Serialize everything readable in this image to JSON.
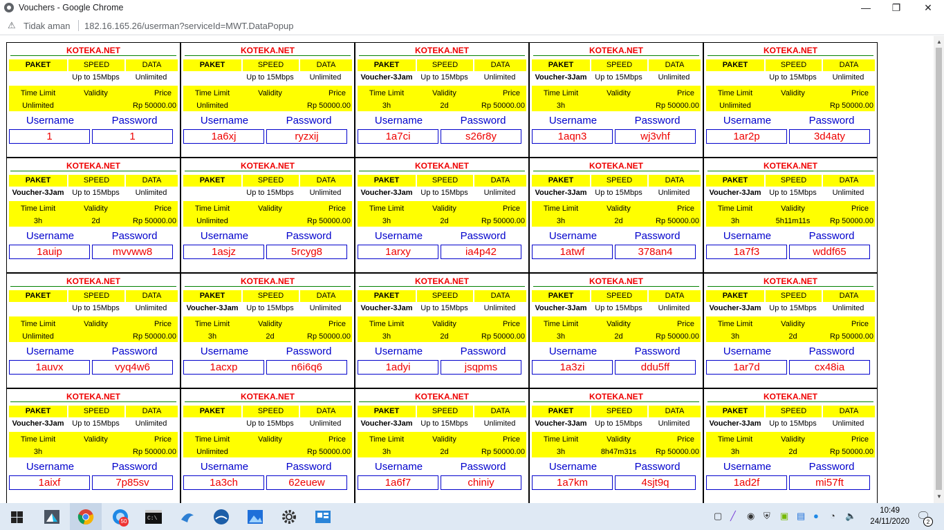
{
  "window": {
    "title": "Vouchers - Google Chrome",
    "minimize": "—",
    "maximize": "❐",
    "close": "✕"
  },
  "address": {
    "warning_icon": "warning-icon",
    "security_label": "Tidak aman",
    "url": "182.16.165.26/userman?serviceId=MWT.DataPopup"
  },
  "labels": {
    "brand": "KOTEKA.NET",
    "paket": "PAKET",
    "speed": "SPEED",
    "data": "DATA",
    "time_limit": "Time Limit",
    "validity": "Validity",
    "price": "Price",
    "username": "Username",
    "password": "Password"
  },
  "vouchers": [
    {
      "paket": "",
      "speed": "Up to 15Mbps",
      "data": "Unlimited",
      "time_limit": "Unlimited",
      "validity": "",
      "price": "Rp 50000.00",
      "username": "1",
      "password": "1"
    },
    {
      "paket": "",
      "speed": "Up to 15Mbps",
      "data": "Unlimited",
      "time_limit": "Unlimited",
      "validity": "",
      "price": "Rp 50000.00",
      "username": "1a6xj",
      "password": "ryzxij"
    },
    {
      "paket": "Voucher-3Jam",
      "speed": "Up to 15Mbps",
      "data": "Unlimited",
      "time_limit": "3h",
      "validity": "2d",
      "price": "Rp 50000.00",
      "username": "1a7ci",
      "password": "s26r8y"
    },
    {
      "paket": "Voucher-3Jam",
      "speed": "Up to 15Mbps",
      "data": "Unlimited",
      "time_limit": "3h",
      "validity": "",
      "price": "Rp 50000.00",
      "username": "1aqn3",
      "password": "wj3vhf"
    },
    {
      "paket": "",
      "speed": "Up to 15Mbps",
      "data": "Unlimited",
      "time_limit": "Unlimited",
      "validity": "",
      "price": "Rp 50000.00",
      "username": "1ar2p",
      "password": "3d4aty"
    },
    {
      "paket": "Voucher-3Jam",
      "speed": "Up to 15Mbps",
      "data": "Unlimited",
      "time_limit": "3h",
      "validity": "2d",
      "price": "Rp 50000.00",
      "username": "1auip",
      "password": "mvvww8"
    },
    {
      "paket": "",
      "speed": "Up to 15Mbps",
      "data": "Unlimited",
      "time_limit": "Unlimited",
      "validity": "",
      "price": "Rp 50000.00",
      "username": "1asjz",
      "password": "5rcyg8"
    },
    {
      "paket": "Voucher-3Jam",
      "speed": "Up to 15Mbps",
      "data": "Unlimited",
      "time_limit": "3h",
      "validity": "2d",
      "price": "Rp 50000.00",
      "username": "1arxy",
      "password": "ia4p42"
    },
    {
      "paket": "Voucher-3Jam",
      "speed": "Up to 15Mbps",
      "data": "Unlimited",
      "time_limit": "3h",
      "validity": "2d",
      "price": "Rp 50000.00",
      "username": "1atwf",
      "password": "378an4"
    },
    {
      "paket": "Voucher-3Jam",
      "speed": "Up to 15Mbps",
      "data": "Unlimited",
      "time_limit": "3h",
      "validity": "5h11m11s",
      "price": "Rp 50000.00",
      "username": "1a7f3",
      "password": "wddf65"
    },
    {
      "paket": "",
      "speed": "Up to 15Mbps",
      "data": "Unlimited",
      "time_limit": "Unlimited",
      "validity": "",
      "price": "Rp 50000.00",
      "username": "1auvx",
      "password": "vyq4w6"
    },
    {
      "paket": "Voucher-3Jam",
      "speed": "Up to 15Mbps",
      "data": "Unlimited",
      "time_limit": "3h",
      "validity": "2d",
      "price": "Rp 50000.00",
      "username": "1acxp",
      "password": "n6i6q6"
    },
    {
      "paket": "Voucher-3Jam",
      "speed": "Up to 15Mbps",
      "data": "Unlimited",
      "time_limit": "3h",
      "validity": "2d",
      "price": "Rp 50000.00",
      "username": "1adyi",
      "password": "jsqpms"
    },
    {
      "paket": "Voucher-3Jam",
      "speed": "Up to 15Mbps",
      "data": "Unlimited",
      "time_limit": "3h",
      "validity": "2d",
      "price": "Rp 50000.00",
      "username": "1a3zi",
      "password": "ddu5ff"
    },
    {
      "paket": "Voucher-3Jam",
      "speed": "Up to 15Mbps",
      "data": "Unlimited",
      "time_limit": "3h",
      "validity": "2d",
      "price": "Rp 50000.00",
      "username": "1ar7d",
      "password": "cx48ia"
    },
    {
      "paket": "Voucher-3Jam",
      "speed": "Up to 15Mbps",
      "data": "Unlimited",
      "time_limit": "3h",
      "validity": "",
      "price": "Rp 50000.00",
      "username": "1aixf",
      "password": "7p85sv"
    },
    {
      "paket": "",
      "speed": "Up to 15Mbps",
      "data": "Unlimited",
      "time_limit": "Unlimited",
      "validity": "",
      "price": "Rp 50000.00",
      "username": "1a3ch",
      "password": "62euew"
    },
    {
      "paket": "Voucher-3Jam",
      "speed": "Up to 15Mbps",
      "data": "Unlimited",
      "time_limit": "3h",
      "validity": "2d",
      "price": "Rp 50000.00",
      "username": "1a6f7",
      "password": "chiniy"
    },
    {
      "paket": "Voucher-3Jam",
      "speed": "Up to 15Mbps",
      "data": "Unlimited",
      "time_limit": "3h",
      "validity": "8h47m31s",
      "price": "Rp 50000.00",
      "username": "1a7km",
      "password": "4sjt9q"
    },
    {
      "paket": "Voucher-3Jam",
      "speed": "Up to 15Mbps",
      "data": "Unlimited",
      "time_limit": "3h",
      "validity": "2d",
      "price": "Rp 50000.00",
      "username": "1ad2f",
      "password": "mi57ft"
    }
  ],
  "taskbar": {
    "badge_count": "50",
    "notification_count": "2",
    "time": "10:49",
    "date": "24/11/2020"
  }
}
